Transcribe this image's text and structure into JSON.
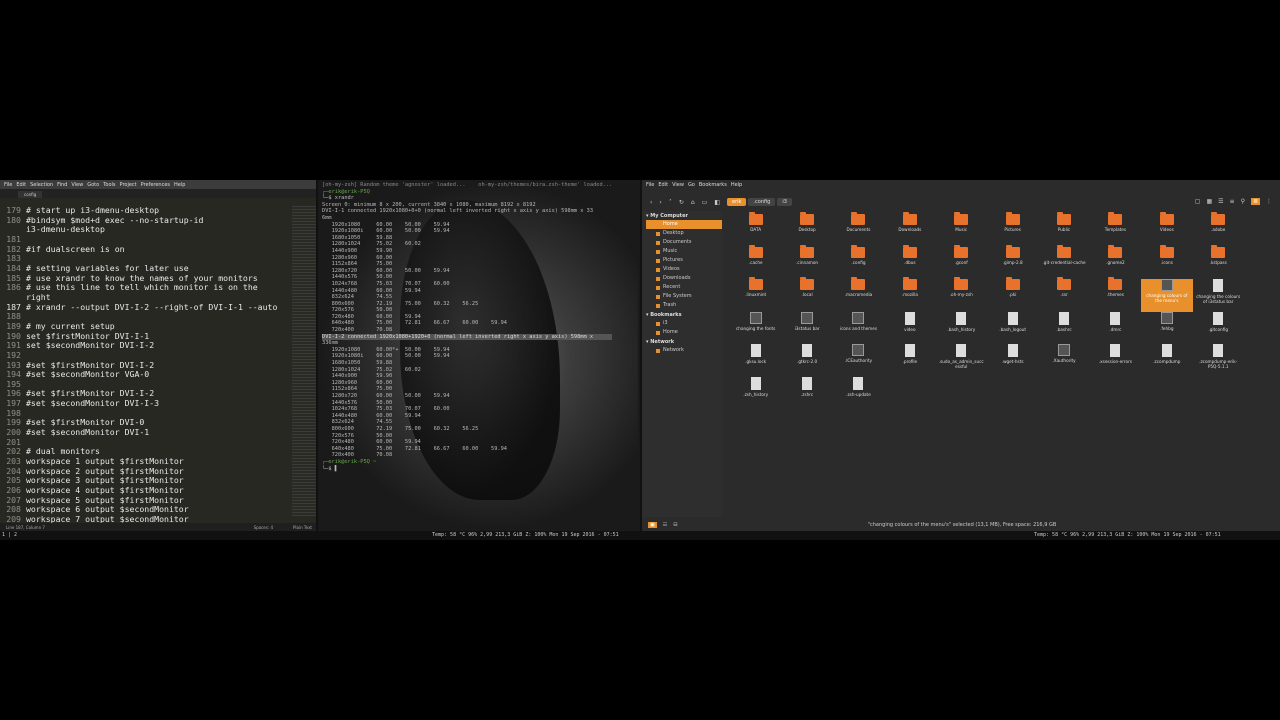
{
  "sublime": {
    "menu": [
      "File",
      "Edit",
      "Selection",
      "Find",
      "View",
      "Goto",
      "Tools",
      "Project",
      "Preferences",
      "Help"
    ],
    "tab": "config",
    "lines": [
      {
        "n": "179",
        "t": "# start up i3-dmenu-desktop"
      },
      {
        "n": "180",
        "t": "#bindsym $mod+d exec --no-startup-id"
      },
      {
        "n": "",
        "t": "i3-dmenu-desktop"
      },
      {
        "n": "181",
        "t": ""
      },
      {
        "n": "182",
        "t": "#if dualscreen is on"
      },
      {
        "n": "183",
        "t": ""
      },
      {
        "n": "184",
        "t": "# setting variables for later use"
      },
      {
        "n": "185",
        "t": "# use xrandr to know the names of your monitors"
      },
      {
        "n": "186",
        "t": "# use this line to tell which monitor is on the"
      },
      {
        "n": "",
        "t": "right"
      },
      {
        "n": "187",
        "t": "# xrandr --output DVI-I-2 --right-of DVI-I-1 --auto"
      },
      {
        "n": "188",
        "t": ""
      },
      {
        "n": "189",
        "t": "# my current setup"
      },
      {
        "n": "190",
        "t": "set $firstMonitor DVI-I-1"
      },
      {
        "n": "191",
        "t": "set $secondMonitor DVI-I-2"
      },
      {
        "n": "192",
        "t": ""
      },
      {
        "n": "193",
        "t": "#set $firstMonitor DVI-I-2"
      },
      {
        "n": "194",
        "t": "#set $secondMonitor VGA-0"
      },
      {
        "n": "195",
        "t": ""
      },
      {
        "n": "196",
        "t": "#set $firstMonitor DVI-I-2"
      },
      {
        "n": "197",
        "t": "#set $secondMonitor DVI-I-3"
      },
      {
        "n": "198",
        "t": ""
      },
      {
        "n": "199",
        "t": "#set $firstMonitor DVI-0"
      },
      {
        "n": "200",
        "t": "#set $secondMonitor DVI-1"
      },
      {
        "n": "201",
        "t": ""
      },
      {
        "n": "202",
        "t": "# dual monitors"
      },
      {
        "n": "203",
        "t": "workspace 1 output $firstMonitor"
      },
      {
        "n": "204",
        "t": "workspace 2 output $firstMonitor"
      },
      {
        "n": "205",
        "t": "workspace 3 output $firstMonitor"
      },
      {
        "n": "206",
        "t": "workspace 4 output $firstMonitor"
      },
      {
        "n": "207",
        "t": "workspace 5 output $firstMonitor"
      },
      {
        "n": "208",
        "t": "workspace 6 output $secondMonitor"
      },
      {
        "n": "209",
        "t": "workspace 7 output $secondMonitor"
      }
    ],
    "status_left": "Line 187, Column 7",
    "status_spaces": "Spaces: 4",
    "status_syntax": "Plain Text"
  },
  "terminal": {
    "lines": [
      {
        "c": "dim",
        "t": "[oh-my-zsh] Random theme 'agnoster' loaded...    oh-my-zsh/themes/bira.zsh-theme' loaded..."
      },
      {
        "c": "green",
        "t": "┌─erik@erik-P5Q"
      },
      {
        "c": "",
        "t": "└─$ xrandr"
      },
      {
        "c": "",
        "t": "Screen 0: minimum 8 x 200, current 3840 x 1080, maximum 8192 x 8192"
      },
      {
        "c": "",
        "t": "DVI-I-1 connected 1920x1080+0+0 (normal left inverted right x axis y axis) 598mm x 33"
      },
      {
        "c": "",
        "t": "6mm"
      },
      {
        "c": "",
        "t": "   1920x1080     60.00    50.00    59.94"
      },
      {
        "c": "",
        "t": "   1920x1080i    60.00    50.00    59.94"
      },
      {
        "c": "",
        "t": "   1680x1050     59.88"
      },
      {
        "c": "",
        "t": "   1280x1024     75.02    60.02"
      },
      {
        "c": "",
        "t": "   1440x900      59.90"
      },
      {
        "c": "",
        "t": "   1280x960      60.00"
      },
      {
        "c": "",
        "t": "   1152x864      75.00"
      },
      {
        "c": "",
        "t": "   1280x720      60.00    50.00    59.94"
      },
      {
        "c": "",
        "t": "   1440x576      50.00"
      },
      {
        "c": "",
        "t": "   1024x768      75.03    70.07    60.00"
      },
      {
        "c": "",
        "t": "   1440x480      60.00    59.94"
      },
      {
        "c": "",
        "t": "   832x624       74.55"
      },
      {
        "c": "",
        "t": "   800x600       72.19    75.00    60.32    56.25"
      },
      {
        "c": "",
        "t": "   720x576       50.00"
      },
      {
        "c": "",
        "t": "   720x480       60.00    59.94"
      },
      {
        "c": "",
        "t": "   640x480       75.00    72.81    66.67    60.00    59.94"
      },
      {
        "c": "",
        "t": "   720x400       70.08"
      },
      {
        "c": "sel",
        "t": "DVI-I-2 connected 1920x1080+1920+0 (normal left inverted right x axis y axis) 598mm x"
      },
      {
        "c": "",
        "t": "336mm"
      },
      {
        "c": "",
        "t": "   1920x1080     60.00*+  50.00    59.94"
      },
      {
        "c": "",
        "t": "   1920x1080i    60.00    50.00    59.94"
      },
      {
        "c": "",
        "t": "   1680x1050     59.88"
      },
      {
        "c": "",
        "t": "   1280x1024     75.02    60.02"
      },
      {
        "c": "",
        "t": "   1440x900      59.90"
      },
      {
        "c": "",
        "t": "   1280x960      60.00"
      },
      {
        "c": "",
        "t": "   1152x864      75.00"
      },
      {
        "c": "",
        "t": "   1280x720      60.00    50.00    59.94"
      },
      {
        "c": "",
        "t": "   1440x576      50.00"
      },
      {
        "c": "",
        "t": "   1024x768      75.03    70.07    60.00"
      },
      {
        "c": "",
        "t": "   1440x480      60.00    59.94"
      },
      {
        "c": "",
        "t": "   832x624       74.55"
      },
      {
        "c": "",
        "t": "   800x600       72.19    75.00    60.32    56.25"
      },
      {
        "c": "",
        "t": "   720x576       50.00"
      },
      {
        "c": "",
        "t": "   720x480       60.00    59.94"
      },
      {
        "c": "",
        "t": "   640x480       75.00    72.81    66.67    60.00    59.94"
      },
      {
        "c": "",
        "t": "   720x400       70.08"
      },
      {
        "c": "green",
        "t": "┌─erik@erik-P5Q ~"
      },
      {
        "c": "",
        "t": "└─$ ▌"
      }
    ]
  },
  "files": {
    "menu": [
      "File",
      "Edit",
      "View",
      "Go",
      "Bookmarks",
      "Help"
    ],
    "crumbs": [
      "erik",
      ".config",
      "i3"
    ],
    "sidebar": [
      {
        "type": "h",
        "label": "My Computer"
      },
      {
        "type": "i",
        "label": "Home",
        "active": true
      },
      {
        "type": "i",
        "label": "Desktop"
      },
      {
        "type": "i",
        "label": "Documents"
      },
      {
        "type": "i",
        "label": "Music"
      },
      {
        "type": "i",
        "label": "Pictures"
      },
      {
        "type": "i",
        "label": "Videos"
      },
      {
        "type": "i",
        "label": "Downloads"
      },
      {
        "type": "i",
        "label": "Recent"
      },
      {
        "type": "i",
        "label": "File System"
      },
      {
        "type": "i",
        "label": "Trash"
      },
      {
        "type": "h",
        "label": "Bookmarks"
      },
      {
        "type": "i",
        "label": "i3"
      },
      {
        "type": "i",
        "label": "Home"
      },
      {
        "type": "h",
        "label": "Network"
      },
      {
        "type": "i",
        "label": "Network"
      }
    ],
    "items": [
      {
        "k": "folder",
        "n": "DATA"
      },
      {
        "k": "folder",
        "n": "Desktop"
      },
      {
        "k": "folder",
        "n": "Documents"
      },
      {
        "k": "folder",
        "n": "Downloads"
      },
      {
        "k": "folder",
        "n": "Music"
      },
      {
        "k": "folder",
        "n": "Pictures"
      },
      {
        "k": "folder",
        "n": "Public"
      },
      {
        "k": "folder",
        "n": "Templates"
      },
      {
        "k": "folder",
        "n": "Videos"
      },
      {
        "k": "folder",
        "n": ".adobe"
      },
      {
        "k": "folder",
        "n": ".cache"
      },
      {
        "k": "folder",
        "n": ".cinnamon"
      },
      {
        "k": "folder",
        "n": ".config"
      },
      {
        "k": "folder",
        "n": ".dbus"
      },
      {
        "k": "folder",
        "n": ".gconf"
      },
      {
        "k": "folder",
        "n": ".gimp-2.8"
      },
      {
        "k": "folder",
        "n": ".git-credential-cache"
      },
      {
        "k": "folder",
        "n": ".gnome2"
      },
      {
        "k": "folder",
        "n": ".icons"
      },
      {
        "k": "folder",
        "n": ".kstpass"
      },
      {
        "k": "folder",
        "n": ".linuxmint"
      },
      {
        "k": "folder",
        "n": ".local"
      },
      {
        "k": "folder",
        "n": ".macromedia"
      },
      {
        "k": "folder",
        "n": ".mozilla"
      },
      {
        "k": "folder",
        "n": ".oh-my-zsh"
      },
      {
        "k": "folder",
        "n": ".pki"
      },
      {
        "k": "folder",
        "n": ".ssr"
      },
      {
        "k": "folder",
        "n": ".themes"
      },
      {
        "k": "img",
        "n": "changing colours of the menu's",
        "sel": true
      },
      {
        "k": "doc",
        "n": "changing the colours of i3status bar"
      },
      {
        "k": "img",
        "n": "changing the fonts"
      },
      {
        "k": "img",
        "n": "i3status bar"
      },
      {
        "k": "img",
        "n": "icons and themes"
      },
      {
        "k": "doc",
        "n": "video"
      },
      {
        "k": "doc",
        "n": ".bash_history"
      },
      {
        "k": "doc",
        "n": ".bash_logout"
      },
      {
        "k": "doc",
        "n": ".bashrc"
      },
      {
        "k": "doc",
        "n": ".dmrc"
      },
      {
        "k": "img",
        "n": ".fehbg"
      },
      {
        "k": "doc",
        "n": ".gitconfig"
      },
      {
        "k": "doc",
        "n": ".gksu.lock"
      },
      {
        "k": "doc",
        "n": ".gtkrc-2.0"
      },
      {
        "k": "img",
        "n": ".ICEauthority"
      },
      {
        "k": "doc",
        "n": ".profile"
      },
      {
        "k": "doc",
        "n": ".sudo_as_admin_successful"
      },
      {
        "k": "doc",
        "n": ".wget-hsts"
      },
      {
        "k": "img",
        "n": ".Xauthority"
      },
      {
        "k": "doc",
        "n": ".xsession-errors"
      },
      {
        "k": "doc",
        "n": ".zcompdump"
      },
      {
        "k": "doc",
        "n": ".zcompdump-erik-P5Q-5.1.1"
      },
      {
        "k": "doc",
        "n": ".zsh_history"
      },
      {
        "k": "doc",
        "n": ".zshrc"
      },
      {
        "k": "doc",
        "n": ".zsh-update"
      }
    ],
    "status": "\"changing colours of the menu's\" selected (13,1 MB), Free space: 216,9 GB"
  },
  "bar": {
    "left": "1 | 2",
    "mid": "Temp: 58 °C 96% 2,99 213,3 GiB Z: 100% Mon 19 Sep 2016 - 07:51",
    "right": "Temp: 58 °C 96% 2,99 213,3 GiB Z: 100% Mon 19 Sep 2016 - 07:51"
  },
  "colors": {
    "accent": "#e8912c",
    "folder": "#e8722c",
    "editor_bg": "#272822"
  }
}
